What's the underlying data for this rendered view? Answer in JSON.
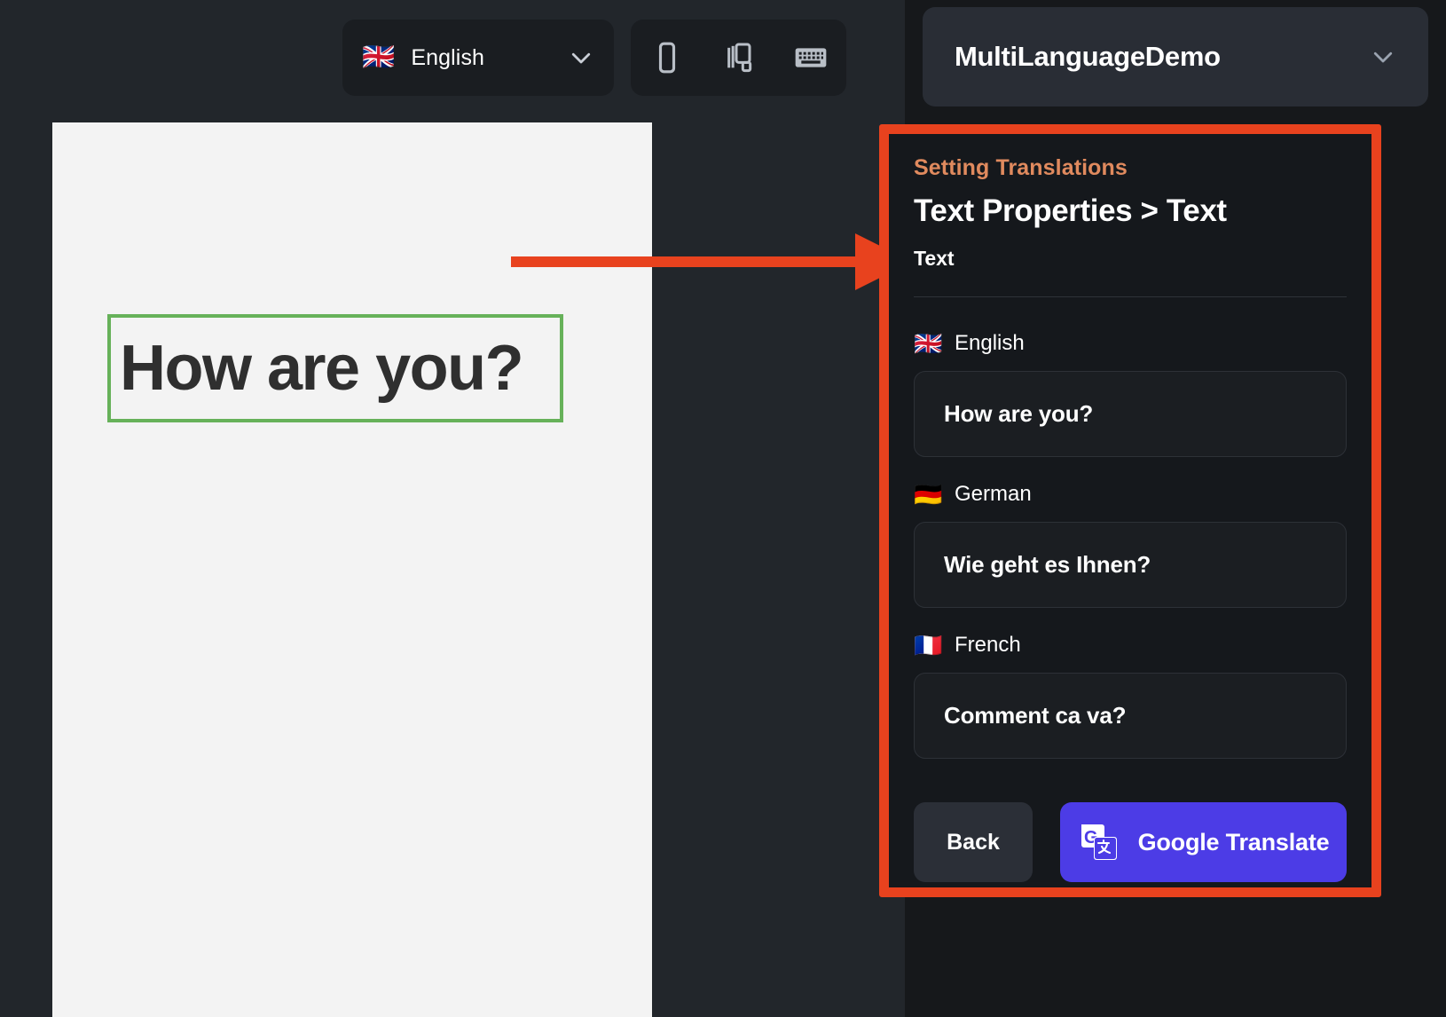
{
  "workspace": {
    "language_selector": {
      "flag": "🇬🇧",
      "label": "English",
      "chevron_icon": "chevron-down-icon"
    },
    "device_buttons": [
      {
        "icon": "phone-icon",
        "label": "Phone preview"
      },
      {
        "icon": "responsive-devices-icon",
        "label": "Responsive preview"
      },
      {
        "icon": "keyboard-icon",
        "label": "Keyboard"
      }
    ],
    "canvas": {
      "selected_element_text": "How are you?",
      "selection_color": "#66b159"
    },
    "annotation": {
      "arrow_color": "#e8421e",
      "highlight_box_color": "#e8421e"
    }
  },
  "panel": {
    "project": {
      "name": "MultiLanguageDemo",
      "chevron_icon": "chevron-down-icon"
    },
    "kicker": "Setting Translations",
    "breadcrumb": "Text Properties > Text",
    "property_label": "Text",
    "kicker_color": "#e08a5e",
    "translations": [
      {
        "flag": "🇬🇧",
        "language": "English",
        "value": "How are you?"
      },
      {
        "flag": "🇩🇪",
        "language": "German",
        "value": "Wie geht es Ihnen?"
      },
      {
        "flag": "🇫🇷",
        "language": "French",
        "value": "Comment ca va?"
      }
    ],
    "actions": {
      "back_label": "Back",
      "translate_label": "Google Translate",
      "translate_icon": "google-translate-icon",
      "translate_color": "#4c3ce6"
    }
  }
}
